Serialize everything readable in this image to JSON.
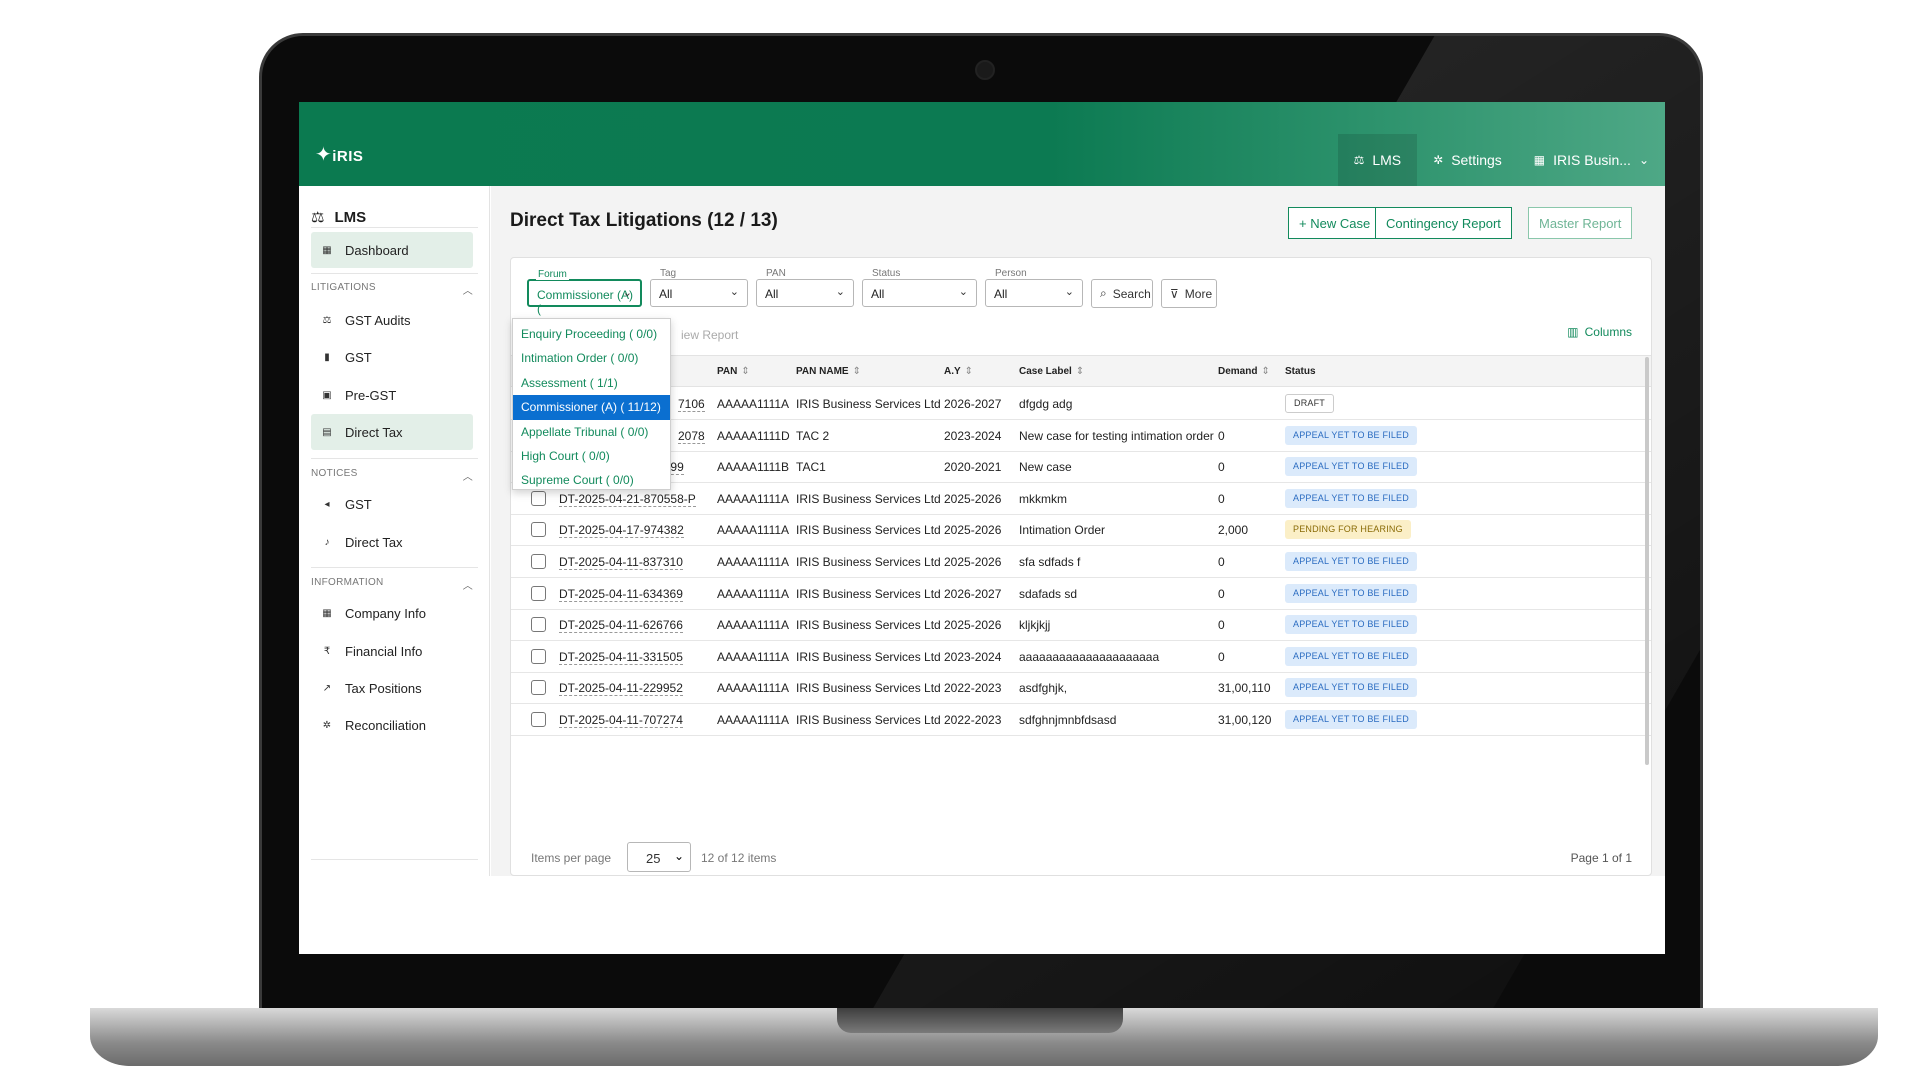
{
  "header": {
    "logo": "iRIS",
    "nav": [
      {
        "icon": "gavel-icon",
        "glyph": "⚖",
        "label": "LMS",
        "active": true
      },
      {
        "icon": "gear-icon",
        "glyph": "✲",
        "label": "Settings",
        "active": false
      },
      {
        "icon": "building-icon",
        "glyph": "▦",
        "label": "IRIS Busin...",
        "active": false
      }
    ]
  },
  "sidebar": {
    "title": "LMS",
    "dashboard": "Dashboard",
    "sections": {
      "litigations": "LITIGATIONS",
      "notices": "NOTICES",
      "information": "INFORMATION"
    },
    "litigations": [
      {
        "icon": "audit-icon",
        "label": "GST Audits"
      },
      {
        "icon": "file-icon",
        "label": "GST"
      },
      {
        "icon": "archive-icon",
        "label": "Pre-GST"
      },
      {
        "icon": "folder-icon",
        "label": "Direct Tax"
      }
    ],
    "notices": [
      {
        "icon": "megaphone-icon",
        "label": "GST"
      },
      {
        "icon": "bell-icon",
        "label": "Direct Tax"
      }
    ],
    "information": [
      {
        "icon": "building-icon",
        "label": "Company Info"
      },
      {
        "icon": "rupee-icon",
        "label": "Financial Info"
      },
      {
        "icon": "trend-icon",
        "label": "Tax Positions"
      },
      {
        "icon": "puzzle-icon",
        "label": "Reconciliation"
      }
    ]
  },
  "main": {
    "title": "Direct Tax Litigations (12 / 13)",
    "buttons": {
      "new_case": "+ New Case",
      "contingency": "Contingency Report",
      "master": "Master Report"
    },
    "filters": {
      "forum": {
        "label": "Forum",
        "value": "Commissioner (A) ("
      },
      "tag": {
        "label": "Tag",
        "value": "All"
      },
      "pan": {
        "label": "PAN",
        "value": "All"
      },
      "status": {
        "label": "Status",
        "value": "All"
      },
      "person": {
        "label": "Person",
        "value": "All"
      }
    },
    "search_button": "Search",
    "more_button": "More",
    "columns_link": "Columns",
    "ghost_text": "iew Report",
    "forum_options": [
      {
        "label": "Enquiry Proceeding ( 0/0)",
        "selected": false
      },
      {
        "label": "Intimation Order ( 0/0)",
        "selected": false
      },
      {
        "label": "Assessment ( 1/1)",
        "selected": false
      },
      {
        "label": "Commissioner (A) ( 11/12)",
        "selected": true
      },
      {
        "label": "Appellate Tribunal ( 0/0)",
        "selected": false
      },
      {
        "label": "High Court ( 0/0)",
        "selected": false
      },
      {
        "label": "Supreme Court ( 0/0)",
        "selected": false
      }
    ],
    "table": {
      "columns": [
        "PAN",
        "PAN NAME",
        "A.Y",
        "Case Label",
        "Demand",
        "Status"
      ],
      "rows": [
        {
          "case_id": "7106",
          "pan": "AAAAA1111A",
          "pan_name": "IRIS Business Services Ltd",
          "ay": "2026-2027",
          "label": "dfgdg adg",
          "demand": "",
          "status": "DRAFT",
          "status_type": "draft"
        },
        {
          "case_id": "2078",
          "pan": "AAAAA1111D",
          "pan_name": "TAC 2",
          "ay": "2023-2024",
          "label": "New case for testing intimation order",
          "demand": "0",
          "status": "APPEAL YET TO BE FILED",
          "status_type": "blue"
        },
        {
          "case_id": "DT-2025-04-24-559599",
          "pan": "AAAAA1111B",
          "pan_name": "TAC1",
          "ay": "2020-2021",
          "label": "New case",
          "demand": "0",
          "status": "APPEAL YET TO BE FILED",
          "status_type": "blue"
        },
        {
          "case_id": "DT-2025-04-21-870558-P",
          "pan": "AAAAA1111A",
          "pan_name": "IRIS Business Services Ltd",
          "ay": "2025-2026",
          "label": "mkkmkm",
          "demand": "0",
          "status": "APPEAL YET TO BE FILED",
          "status_type": "blue"
        },
        {
          "case_id": "DT-2025-04-17-974382",
          "pan": "AAAAA1111A",
          "pan_name": "IRIS Business Services Ltd",
          "ay": "2025-2026",
          "label": "Intimation Order",
          "demand": "2,000",
          "status": "PENDING FOR HEARING",
          "status_type": "yellow"
        },
        {
          "case_id": "DT-2025-04-11-837310",
          "pan": "AAAAA1111A",
          "pan_name": "IRIS Business Services Ltd",
          "ay": "2025-2026",
          "label": "sfa sdfads f",
          "demand": "0",
          "status": "APPEAL YET TO BE FILED",
          "status_type": "blue"
        },
        {
          "case_id": "DT-2025-04-11-634369",
          "pan": "AAAAA1111A",
          "pan_name": "IRIS Business Services Ltd",
          "ay": "2026-2027",
          "label": "sdafads sd",
          "demand": "0",
          "status": "APPEAL YET TO BE FILED",
          "status_type": "blue"
        },
        {
          "case_id": "DT-2025-04-11-626766",
          "pan": "AAAAA1111A",
          "pan_name": "IRIS Business Services Ltd",
          "ay": "2025-2026",
          "label": "kljkjkjj",
          "demand": "0",
          "status": "APPEAL YET TO BE FILED",
          "status_type": "blue"
        },
        {
          "case_id": "DT-2025-04-11-331505",
          "pan": "AAAAA1111A",
          "pan_name": "IRIS Business Services Ltd",
          "ay": "2023-2024",
          "label": "aaaaaaaaaaaaaaaaaaaaa",
          "demand": "0",
          "status": "APPEAL YET TO BE FILED",
          "status_type": "blue"
        },
        {
          "case_id": "DT-2025-04-11-229952",
          "pan": "AAAAA1111A",
          "pan_name": "IRIS Business Services Ltd",
          "ay": "2022-2023",
          "label": "asdfghjk,",
          "demand": "31,00,110",
          "status": "APPEAL YET TO BE FILED",
          "status_type": "blue"
        },
        {
          "case_id": "DT-2025-04-11-707274",
          "pan": "AAAAA1111A",
          "pan_name": "IRIS Business Services Ltd",
          "ay": "2022-2023",
          "label": "sdfghnjmnbfdsasd",
          "demand": "31,00,120",
          "status": "APPEAL YET TO BE FILED",
          "status_type": "blue"
        }
      ]
    },
    "pagination": {
      "items_per_page_label": "Items per page",
      "items_per_page": "25",
      "count": "12 of 12 items",
      "page": "Page 1 of 1"
    }
  },
  "colors": {
    "brand_green": "#0b7a50",
    "link_green": "#128a5c",
    "selected_blue": "#0b6fd0",
    "badge_blue_bg": "#dbeafb",
    "badge_yellow_bg": "#fbefc7"
  }
}
